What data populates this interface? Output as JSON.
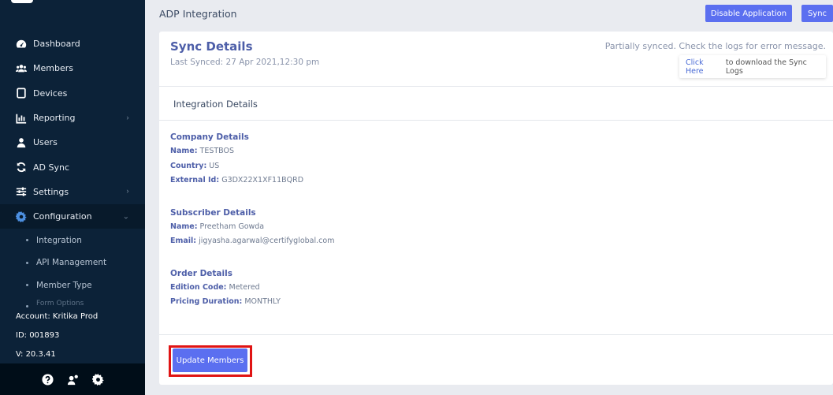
{
  "sidebar": {
    "items": [
      {
        "label": "Dashboard",
        "icon": "dashboard-icon"
      },
      {
        "label": "Members",
        "icon": "members-icon"
      },
      {
        "label": "Devices",
        "icon": "devices-icon"
      },
      {
        "label": "Reporting",
        "icon": "reporting-icon"
      },
      {
        "label": "Users",
        "icon": "users-icon"
      },
      {
        "label": "AD Sync",
        "icon": "sync-icon"
      },
      {
        "label": "Settings",
        "icon": "settings-sliders-icon"
      },
      {
        "label": "Configuration",
        "icon": "gear-icon"
      }
    ],
    "sub_items": [
      {
        "label": "Integration"
      },
      {
        "label": "API Management"
      },
      {
        "label": "Member Type"
      },
      {
        "label": "Form Options"
      }
    ],
    "account": {
      "account_label": "Account: Kritika Prod",
      "id_label": "ID: 001893",
      "version_label": "V: 20.3.41"
    }
  },
  "header": {
    "title": "ADP Integration",
    "disable_button": "Disable Application",
    "sync_button": "Sync"
  },
  "sync": {
    "title": "Sync Details",
    "last_synced": "Last Synced: 27 Apr 2021,12:30 pm",
    "status": "Partially synced. Check the logs for error message.",
    "download_link": "Click Here",
    "download_text": "to download the Sync Logs"
  },
  "integration": {
    "heading": "Integration Details",
    "company": {
      "title": "Company Details",
      "name_label": "Name:",
      "name_value": "TESTBOS",
      "country_label": "Country:",
      "country_value": "US",
      "external_label": "External Id:",
      "external_value": "G3DX22X1XF11BQRD"
    },
    "subscriber": {
      "title": "Subscriber Details",
      "name_label": "Name:",
      "name_value": "Preetham Gowda",
      "email_label": "Email:",
      "email_value": "jigyasha.agarwal@certifyglobal.com"
    },
    "order": {
      "title": "Order Details",
      "edition_label": "Edition Code:",
      "edition_value": "Metered",
      "pricing_label": "Pricing Duration:",
      "pricing_value": "MONTHLY"
    }
  },
  "actions": {
    "update_members": "Update Members"
  },
  "colors": {
    "sidebar_bg": "#0c2238",
    "primary": "#5b6ff0",
    "highlight": "#e01414"
  }
}
